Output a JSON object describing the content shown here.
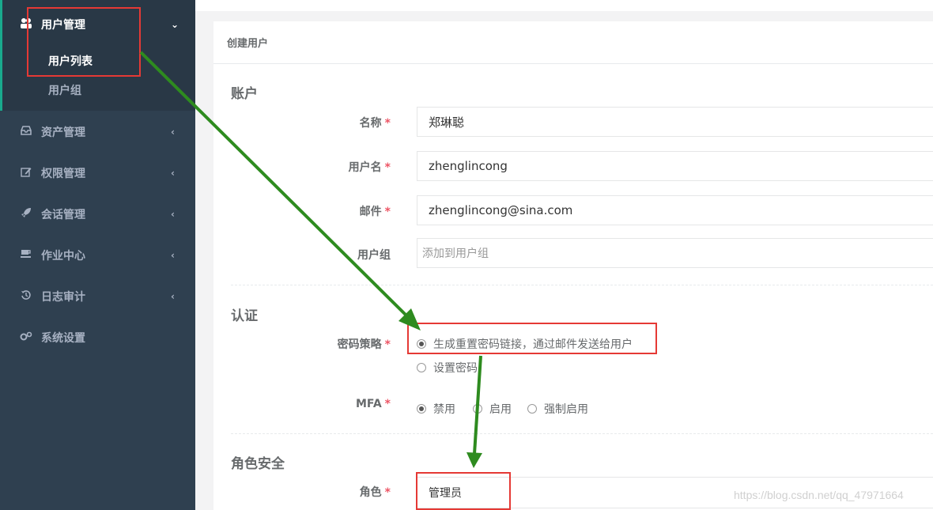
{
  "sidebar": {
    "group_user": {
      "label": "用户管理",
      "icon": "users-icon",
      "children": [
        "用户列表",
        "用户组"
      ]
    },
    "items": [
      {
        "label": "资产管理",
        "icon": "inbox-icon"
      },
      {
        "label": "权限管理",
        "icon": "edit-icon"
      },
      {
        "label": "会话管理",
        "icon": "rocket-icon"
      },
      {
        "label": "作业中心",
        "icon": "coffee-icon"
      },
      {
        "label": "日志审计",
        "icon": "history-icon"
      },
      {
        "label": "系统设置",
        "icon": "gears-icon"
      }
    ]
  },
  "panel": {
    "title": "创建用户"
  },
  "account": {
    "section_title": "账户",
    "name_label": "名称",
    "name_value": "郑琳聪",
    "username_label": "用户名",
    "username_value": "zhenglincong",
    "email_label": "邮件",
    "email_value": "zhenglincong@sina.com",
    "group_label": "用户组",
    "group_placeholder": "添加到用户组"
  },
  "auth": {
    "section_title": "认证",
    "password_label": "密码策略",
    "password_options": [
      "生成重置密码链接，通过邮件发送给用户",
      "设置密码"
    ],
    "password_selected": 0,
    "mfa_label": "MFA",
    "mfa_options": [
      "禁用",
      "启用",
      "强制启用"
    ],
    "mfa_selected": 0
  },
  "role": {
    "section_title": "角色安全",
    "role_label": "角色",
    "role_value": "管理员"
  },
  "required_mark": "*",
  "watermark": "https://blog.csdn.net/qq_47971664",
  "colors": {
    "sidebar_bg": "#2f4050",
    "sidebar_active_bg": "#293846",
    "accent": "#19aa8d",
    "required": "#ed5565",
    "annotation_red": "#e53935",
    "annotation_arrow": "#2e8b1f"
  }
}
